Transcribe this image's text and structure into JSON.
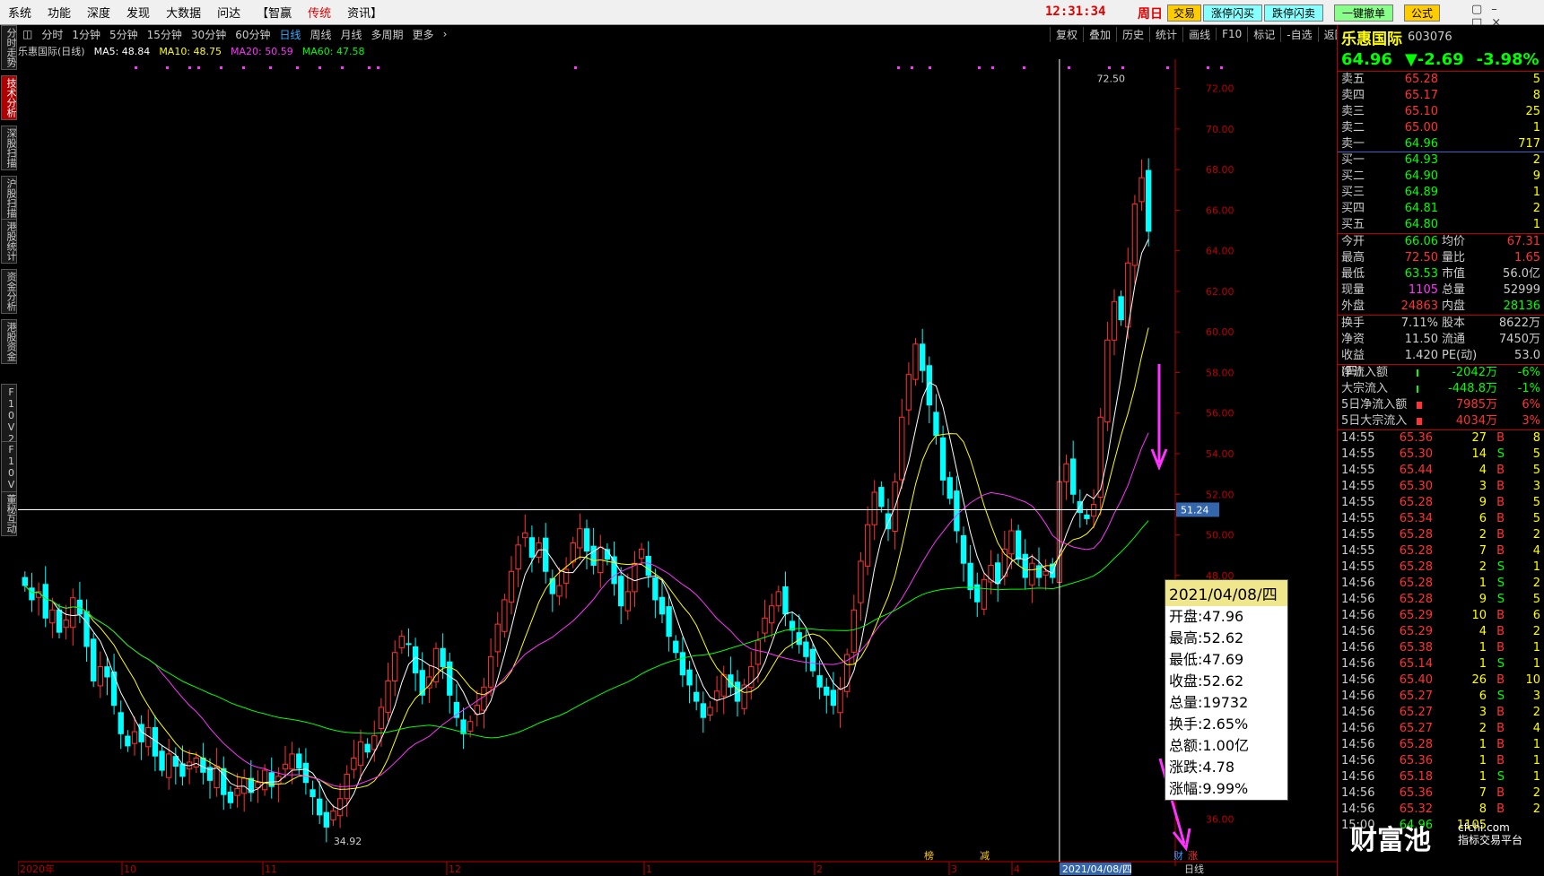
{
  "menu": [
    "系统",
    "功能",
    "深度",
    "发现",
    "大数据",
    "问达",
    "【智赢",
    "传统",
    "资讯】"
  ],
  "clock": "12:31:34",
  "weekday": "周日",
  "toolbar": {
    "trade": "交易",
    "buy": "涨停闪买",
    "sell": "跌停闪卖",
    "cancel": "一键撤单",
    "formula": "公式"
  },
  "left_tabs": [
    "分时走势",
    "技术分析",
    "深股扫描",
    "沪股扫描",
    "港股统计",
    "资金分析",
    "港股资金",
    "F10V2深",
    "F10V2沪",
    "董秘互动"
  ],
  "periods": [
    "分时",
    "1分钟",
    "5分钟",
    "15分钟",
    "30分钟",
    "60分钟",
    "日线",
    "周线",
    "月线",
    "多周期",
    "更多"
  ],
  "active_period": "日线",
  "rtools": [
    "复权",
    "叠加",
    "历史",
    "统计",
    "画线",
    "F10",
    "标记",
    "-自选",
    "返回"
  ],
  "ma": {
    "title": "乐惠国际(日线)",
    "ma5": "MA5: 48.84",
    "ma10": "MA10: 48.75",
    "ma20": "MA20: 50.59",
    "ma60": "MA60: 47.58"
  },
  "chart_data": {
    "type": "candlestick",
    "ylim": [
      35,
      73
    ],
    "yticks": [
      "72.00",
      "70.00",
      "68.00",
      "66.00",
      "64.00",
      "62.00",
      "60.00",
      "58.00",
      "56.00",
      "54.00",
      "52.00",
      "50.00",
      "48.00",
      "46.00",
      "44.00",
      "42.00",
      "40.00",
      "38.00",
      "36.00"
    ],
    "xlabels": [
      "2020年",
      "10",
      "11",
      "12",
      "1",
      "2",
      "3",
      "4"
    ],
    "crosshair_price": "51.24",
    "crosshair_date": "2021/04/08/四",
    "period_label": "日线",
    "high_label": "72.50",
    "low_label": "34.92",
    "tags": [
      "榜",
      "减",
      "财",
      "涨"
    ],
    "closes": [
      47.5,
      46.8,
      47.2,
      45.9,
      46.3,
      45.2,
      45.8,
      46.9,
      46.1,
      44.5,
      42.8,
      43.5,
      43.0,
      41.6,
      40.2,
      39.6,
      40.3,
      39.8,
      40.5,
      39.1,
      38.4,
      39.2,
      38.6,
      38.1,
      38.8,
      39.0,
      38.3,
      37.9,
      38.6,
      37.2,
      36.8,
      37.5,
      38.0,
      37.3,
      37.8,
      38.4,
      37.6,
      38.1,
      38.7,
      39.2,
      38.5,
      37.8,
      37.1,
      36.2,
      35.6,
      36.4,
      37.0,
      38.2,
      39.0,
      39.8,
      39.3,
      40.1,
      41.5,
      42.8,
      44.2,
      45.0,
      44.6,
      43.2,
      42.1,
      43.0,
      44.4,
      43.5,
      42.1,
      41.0,
      40.2,
      40.8,
      41.6,
      42.5,
      44.0,
      45.6,
      46.8,
      48.2,
      49.5,
      50.1,
      48.9,
      49.6,
      48.2,
      47.1,
      47.5,
      48.3,
      49.6,
      50.3,
      49.2,
      48.5,
      49.4,
      48.8,
      47.6,
      46.5,
      47.2,
      48.6,
      49.3,
      48.0,
      46.8,
      46.1,
      45.0,
      44.2,
      43.1,
      42.6,
      41.8,
      41.0,
      41.5,
      42.3,
      43.1,
      42.5,
      41.8,
      42.6,
      43.5,
      44.8,
      45.9,
      46.5,
      47.2,
      46.1,
      45.3,
      44.6,
      44.0,
      43.3,
      42.5,
      42.1,
      41.6,
      42.4,
      44.1,
      46.3,
      48.7,
      50.5,
      52.1,
      51.4,
      50.3,
      52.6,
      55.8,
      57.9,
      59.4,
      58.1,
      56.4,
      54.9,
      52.7,
      51.8,
      50.2,
      48.6,
      47.3,
      46.7,
      47.8,
      48.5,
      47.6,
      49.3,
      50.2,
      48.8,
      47.9,
      48.6,
      47.9,
      48.2,
      47.9,
      52.62,
      53.5,
      52.0,
      51.1,
      50.8,
      51.5,
      55.8,
      59.6,
      61.5,
      60.6,
      63.4,
      66.3,
      67.6,
      64.96
    ],
    "stats": {
      "open": "47.96",
      "high": "52.62",
      "low": "47.69",
      "close": "52.62",
      "volume": "19732",
      "turnover": "2.65%",
      "amount": "1.00亿",
      "change": "4.78",
      "pct": "9.99%"
    }
  },
  "tooltip": {
    "date": "2021/04/08/四",
    "rows": [
      "开盘:47.96",
      "最高:52.62",
      "最低:47.69",
      "收盘:52.62",
      "总量:19732",
      "换手:2.65%",
      "总额:1.00亿",
      "涨跌:4.78",
      "涨幅:9.99%"
    ]
  },
  "quote": {
    "name": "乐惠国际",
    "code": "603076",
    "price": "64.96",
    "change": "▼-2.69",
    "pct": "-3.98%",
    "asks": [
      [
        "卖五",
        "65.28",
        "5"
      ],
      [
        "卖四",
        "65.17",
        "8"
      ],
      [
        "卖三",
        "65.10",
        "25"
      ],
      [
        "卖二",
        "65.00",
        "1"
      ],
      [
        "卖一",
        "64.96",
        "717"
      ]
    ],
    "bids": [
      [
        "买一",
        "64.93",
        "2"
      ],
      [
        "买二",
        "64.90",
        "9"
      ],
      [
        "买三",
        "64.89",
        "1"
      ],
      [
        "买四",
        "64.81",
        "2"
      ],
      [
        "买五",
        "64.80",
        "1"
      ]
    ],
    "stats": [
      [
        "今开",
        "66.06",
        "均价",
        "67.31"
      ],
      [
        "最高",
        "72.50",
        "量比",
        "1.65"
      ],
      [
        "最低",
        "63.53",
        "市值",
        "56.0亿"
      ],
      [
        "现量",
        "1105",
        "总量",
        "52999"
      ],
      [
        "外盘",
        "24863",
        "内盘",
        "28136"
      ]
    ],
    "stats2": [
      [
        "换手",
        "7.11%",
        "股本",
        "8622万"
      ],
      [
        "净资",
        "11.50",
        "流通",
        "7450万"
      ],
      [
        "收益(四)",
        "1.420",
        "PE(动)",
        "53.0"
      ]
    ],
    "flows": [
      [
        "净流入额",
        "-2042万",
        "-6%"
      ],
      [
        "大宗流入",
        "-448.8万",
        "-1%"
      ],
      [
        "5日净流入额",
        "7985万",
        "6%"
      ],
      [
        "5日大宗流入",
        "4034万",
        "3%"
      ]
    ],
    "ticks": [
      [
        "14:55",
        "65.36",
        "27",
        "B",
        "8"
      ],
      [
        "14:55",
        "65.30",
        "14",
        "S",
        "5"
      ],
      [
        "14:55",
        "65.44",
        "4",
        "B",
        "5"
      ],
      [
        "14:55",
        "65.30",
        "3",
        "B",
        "3"
      ],
      [
        "14:55",
        "65.28",
        "9",
        "B",
        "5"
      ],
      [
        "14:55",
        "65.34",
        "6",
        "B",
        "5"
      ],
      [
        "14:55",
        "65.28",
        "2",
        "B",
        "2"
      ],
      [
        "14:55",
        "65.28",
        "7",
        "B",
        "4"
      ],
      [
        "14:55",
        "65.28",
        "2",
        "S",
        "1"
      ],
      [
        "14:56",
        "65.28",
        "1",
        "S",
        "2"
      ],
      [
        "14:56",
        "65.28",
        "9",
        "S",
        "5"
      ],
      [
        "14:56",
        "65.29",
        "10",
        "B",
        "6"
      ],
      [
        "14:56",
        "65.29",
        "4",
        "B",
        "2"
      ],
      [
        "14:56",
        "65.38",
        "1",
        "B",
        "1"
      ],
      [
        "14:56",
        "65.14",
        "1",
        "S",
        "1"
      ],
      [
        "14:56",
        "65.40",
        "26",
        "B",
        "10"
      ],
      [
        "14:56",
        "65.27",
        "6",
        "S",
        "3"
      ],
      [
        "14:56",
        "65.27",
        "3",
        "B",
        "2"
      ],
      [
        "14:56",
        "65.27",
        "2",
        "B",
        "4"
      ],
      [
        "14:56",
        "65.28",
        "1",
        "B",
        "1"
      ],
      [
        "14:56",
        "65.36",
        "1",
        "B",
        "1"
      ],
      [
        "14:56",
        "65.18",
        "1",
        "S",
        "1"
      ],
      [
        "14:56",
        "65.36",
        "7",
        "B",
        "2"
      ],
      [
        "14:56",
        "65.32",
        "8",
        "B",
        "2"
      ],
      [
        "15:00",
        "64.96",
        "1105",
        "",
        ""
      ]
    ]
  },
  "watermark": {
    "brand": "财富池",
    "site": "cfchi.com",
    "slogan": "指标交易平台"
  }
}
